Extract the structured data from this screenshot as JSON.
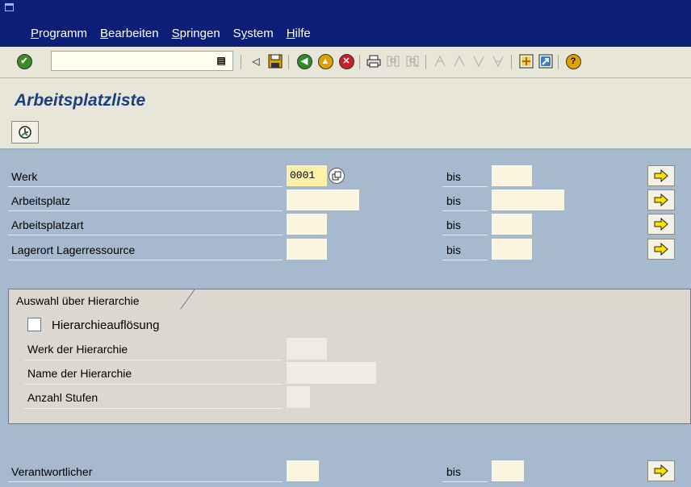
{
  "menu": {
    "items": [
      {
        "accel": "P",
        "rest": "rogramm"
      },
      {
        "accel": "B",
        "rest": "earbeiten"
      },
      {
        "accel": "S",
        "rest": "pringen"
      },
      {
        "pre": "S",
        "accel": "y",
        "rest": "stem"
      },
      {
        "accel": "H",
        "rest": "ilfe"
      }
    ]
  },
  "toolbar": {
    "command_value": ""
  },
  "page": {
    "title": "Arbeitsplatzliste"
  },
  "form": {
    "rows": [
      {
        "label": "Werk",
        "value": "0001",
        "bis": "bis",
        "to_value": ""
      },
      {
        "label": "Arbeitsplatz",
        "value": "",
        "bis": "bis",
        "to_value": ""
      },
      {
        "label": "Arbeitsplatzart",
        "value": "",
        "bis": "bis",
        "to_value": ""
      },
      {
        "label": "Lagerort Lagerressource",
        "value": "",
        "bis": "bis",
        "to_value": ""
      }
    ],
    "group": {
      "title": "Auswahl über Hierarchie",
      "checkbox_label": "Hierarchieauflösung",
      "checkbox_checked": false,
      "fields": [
        {
          "label": "Werk der Hierarchie",
          "value": ""
        },
        {
          "label": "Name der Hierarchie",
          "value": ""
        },
        {
          "label": "Anzahl Stufen",
          "value": ""
        }
      ]
    },
    "responsible": {
      "label": "Verantwortlicher",
      "value": "",
      "bis": "bis",
      "to_value": ""
    }
  },
  "colors": {
    "titlebar": "#0c1e78",
    "background": "#a6b9ce",
    "toolbar": "#e8e6d8",
    "title_text": "#1e3e82",
    "input_bg": "#fbf6e0",
    "input_filled": "#fff1a8"
  }
}
